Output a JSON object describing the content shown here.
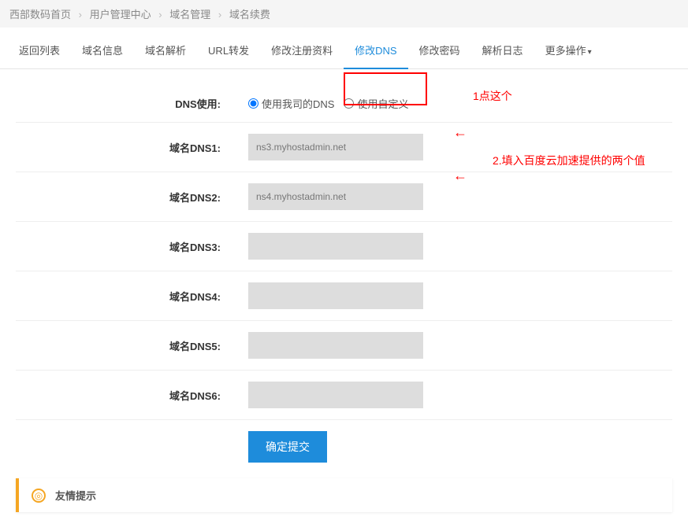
{
  "breadcrumb": {
    "items": [
      "西部数码首页",
      "用户管理中心",
      "域名管理",
      "域名续费"
    ]
  },
  "tabs": {
    "items": [
      {
        "label": "返回列表"
      },
      {
        "label": "域名信息"
      },
      {
        "label": "域名解析"
      },
      {
        "label": "URL转发"
      },
      {
        "label": "修改注册资料"
      },
      {
        "label": "修改DNS",
        "active": true
      },
      {
        "label": "修改密码"
      },
      {
        "label": "解析日志"
      },
      {
        "label": "更多操作"
      }
    ]
  },
  "form": {
    "dns_use_label": "DNS使用:",
    "radio_company": "使用我司的DNS",
    "radio_custom": "使用自定义",
    "dns_labels": [
      "域名DNS1:",
      "域名DNS2:",
      "域名DNS3:",
      "域名DNS4:",
      "域名DNS5:",
      "域名DNS6:"
    ],
    "dns_values": [
      "ns3.myhostadmin.net",
      "ns4.myhostadmin.net",
      "",
      "",
      "",
      ""
    ],
    "submit": "确定提交"
  },
  "annotations": {
    "a1": "1点这个",
    "a2": "2.填入百度云加速提供的两个值",
    "arrow": "←"
  },
  "tip": {
    "label": "友情提示"
  }
}
